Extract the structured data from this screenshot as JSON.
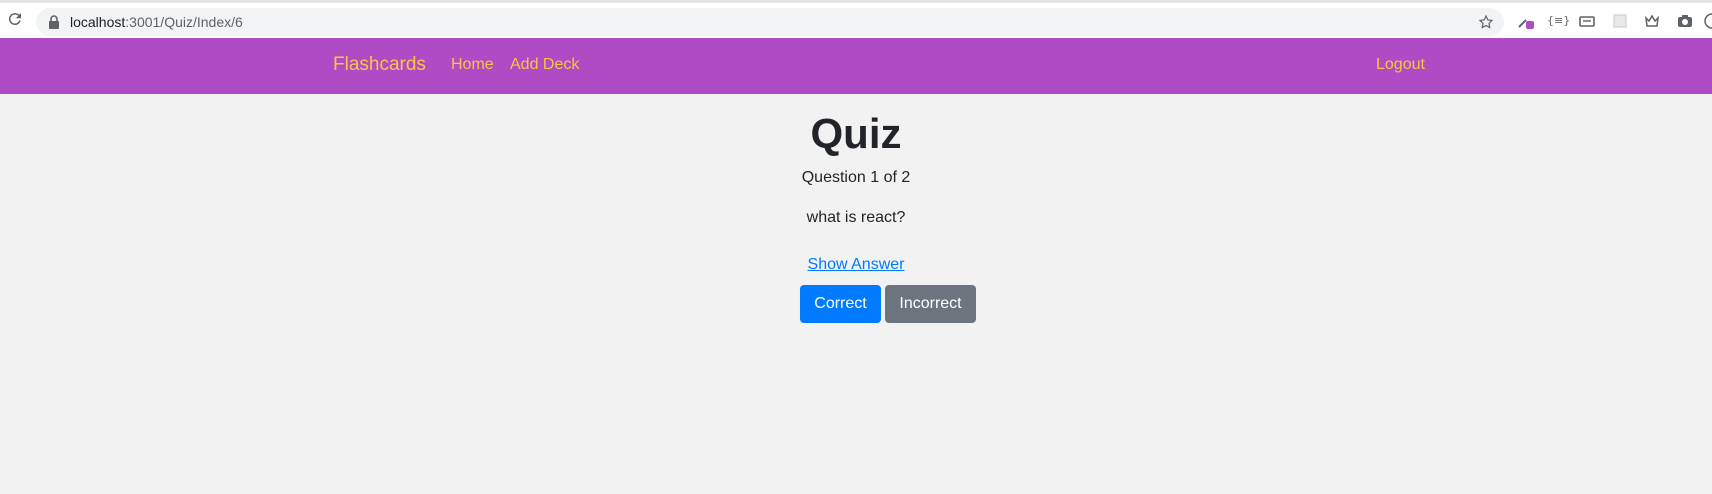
{
  "browser": {
    "url_host": "localhost",
    "url_path": ":3001/Quiz/Index/6",
    "extensions": [
      "eyedropper-icon",
      "json-icon",
      "reader-icon",
      "grid-icon",
      "crown-icon",
      "camera-icon"
    ]
  },
  "navbar": {
    "brand": "Flashcards",
    "links": {
      "home": "Home",
      "add_deck": "Add Deck",
      "logout": "Logout"
    },
    "bg_color": "#b04bc6",
    "link_color": "#f6c544"
  },
  "quiz": {
    "title": "Quiz",
    "counter": "Question 1 of 2",
    "question": "what is react?",
    "show_answer": "Show Answer",
    "correct_label": "Correct",
    "incorrect_label": "Incorrect"
  }
}
